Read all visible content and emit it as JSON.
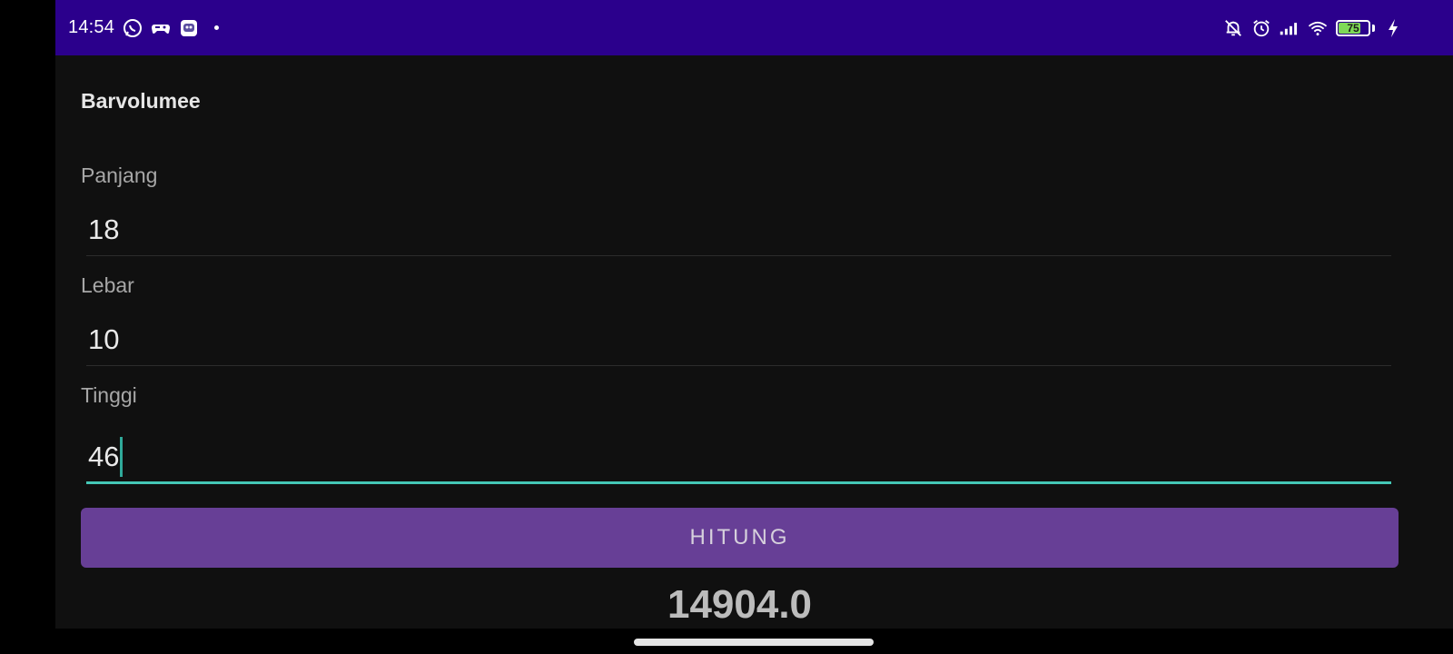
{
  "status_bar": {
    "time": "14:54",
    "left_icons": [
      "whatsapp-icon",
      "game-controller-icon",
      "robot-app-icon"
    ],
    "right_icons": [
      "bell-off-icon",
      "alarm-icon",
      "signal-icon",
      "wifi-icon"
    ],
    "battery_level": "75",
    "battery_fraction": 0.75,
    "charging": true
  },
  "app": {
    "title": "Barvolumee"
  },
  "form": {
    "panjang": {
      "label": "Panjang",
      "value": "18"
    },
    "lebar": {
      "label": "Lebar",
      "value": "10"
    },
    "tinggi": {
      "label": "Tinggi",
      "value": "46"
    }
  },
  "button": {
    "label": "HITUNG"
  },
  "result": {
    "value": "14904.0"
  },
  "colors": {
    "status_bar": "#2b008c",
    "background": "#101010",
    "button": "#673f96",
    "focus_accent": "#44c7b6"
  }
}
